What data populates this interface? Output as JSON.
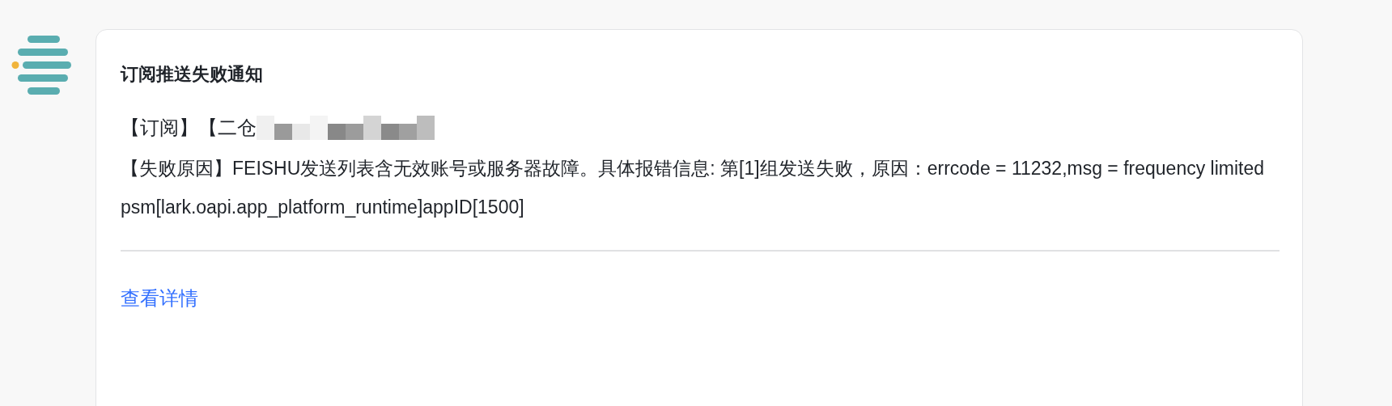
{
  "card": {
    "title": "订阅推送失败通知",
    "subscription_line": "【订阅】【二仓",
    "failure_reason": "【失败原因】FEISHU发送列表含无效账号或服务器故障。具体报错信息: 第[1]组发送失败，原因：errcode = 11232,msg = frequency limited",
    "psm_line": "psm[lark.oapi.app_platform_runtime]appID[1500]",
    "link": "查看详情"
  }
}
